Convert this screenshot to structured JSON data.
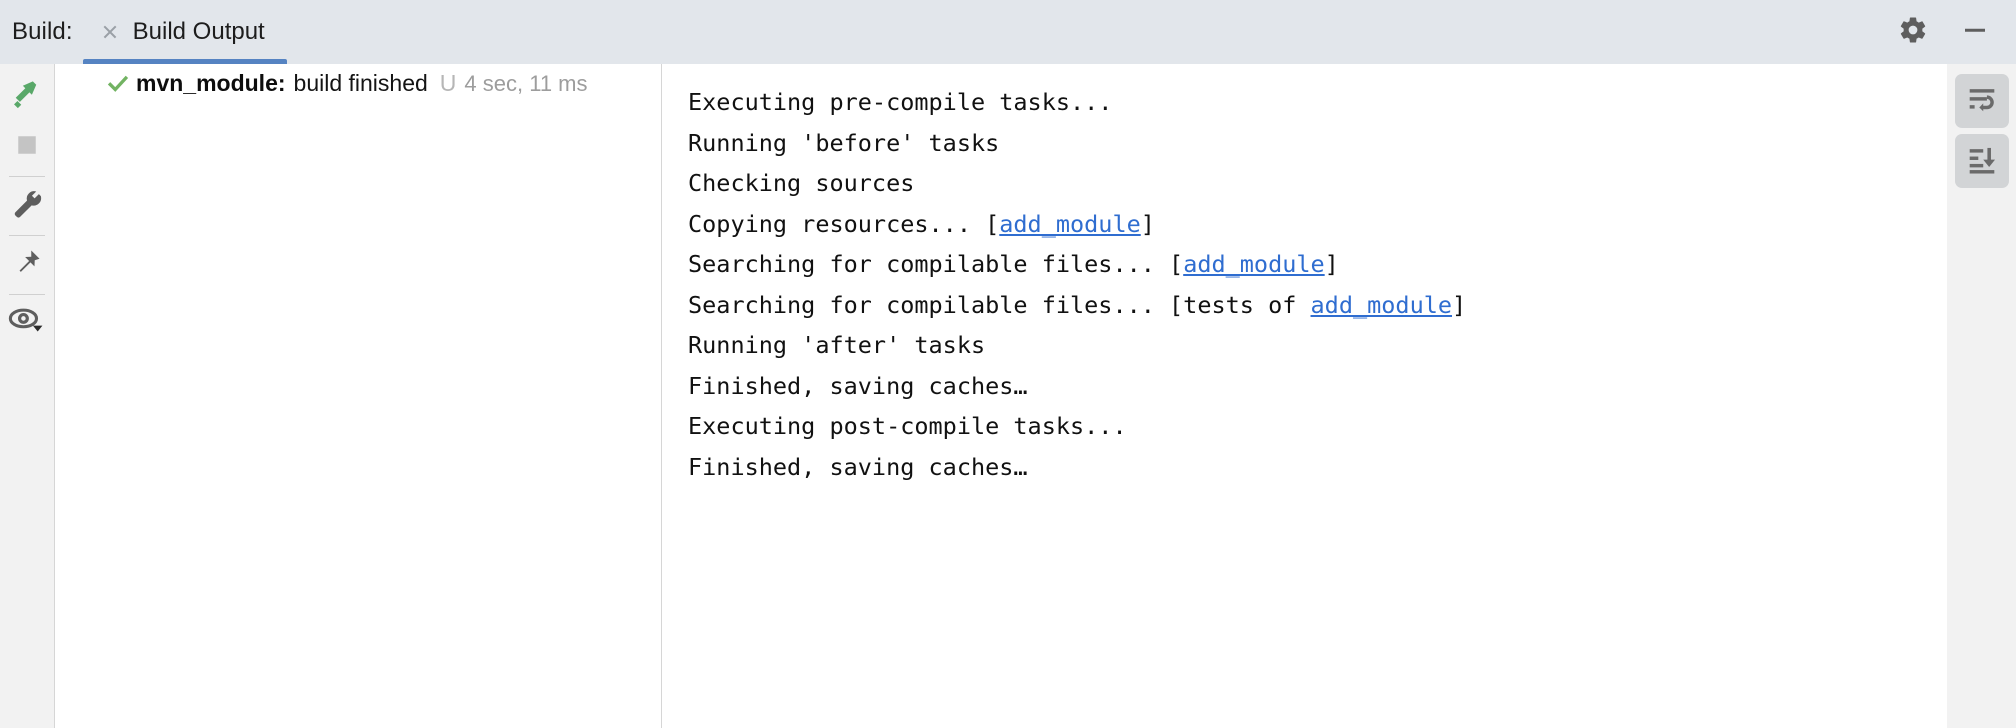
{
  "header": {
    "title": "Build:",
    "tab": {
      "label": "Build Output",
      "close_icon": "close-icon",
      "active": true
    },
    "actions": [
      {
        "name": "settings-button",
        "icon": "gear-icon",
        "label": ""
      },
      {
        "name": "minimize-button",
        "icon": "minimize-icon",
        "label": ""
      }
    ],
    "accent_color": "#5583c2",
    "background_color": "#e2e6eb"
  },
  "left_toolbar": {
    "items": [
      {
        "name": "rerun-build-button",
        "icon": "hammer-icon",
        "color": "#59a869"
      },
      {
        "name": "stop-build-button",
        "icon": "stop-square-icon",
        "color": "#c4c4c4"
      },
      {
        "name": "build-settings-button",
        "icon": "wrench-icon",
        "color": "#5e5e5e"
      },
      {
        "name": "pin-tab-button",
        "icon": "pin-icon",
        "color": "#5e5e5e"
      },
      {
        "name": "show-filters-button",
        "icon": "eye-icon",
        "color": "#5e5e5e"
      }
    ]
  },
  "right_toolbar": {
    "items": [
      {
        "name": "soft-wrap-button",
        "icon": "soft-wrap-icon"
      },
      {
        "name": "scroll-to-end-button",
        "icon": "scroll-to-end-icon"
      }
    ]
  },
  "tree": {
    "rows": [
      {
        "name": "build-result-row",
        "status_icon": "green-check-icon",
        "module": "mvn_module:",
        "status": "build finished",
        "separator": "U",
        "duration": "4 sec, 11 ms",
        "duration_color": "#9d9d9d"
      }
    ]
  },
  "console": {
    "lines": [
      {
        "segments": [
          {
            "t": "Executing pre-compile tasks...",
            "link": false
          }
        ]
      },
      {
        "segments": [
          {
            "t": "Running 'before' tasks",
            "link": false
          }
        ]
      },
      {
        "segments": [
          {
            "t": "Checking sources",
            "link": false
          }
        ]
      },
      {
        "segments": [
          {
            "t": "Copying resources... [",
            "link": false
          },
          {
            "t": "add_module",
            "link": true
          },
          {
            "t": "]",
            "link": false
          }
        ]
      },
      {
        "segments": [
          {
            "t": "Searching for compilable files... [",
            "link": false
          },
          {
            "t": "add_module",
            "link": true
          },
          {
            "t": "]",
            "link": false
          }
        ]
      },
      {
        "segments": [
          {
            "t": "Searching for compilable files... [tests of ",
            "link": false
          },
          {
            "t": "add_module",
            "link": true
          },
          {
            "t": "]",
            "link": false
          }
        ]
      },
      {
        "segments": [
          {
            "t": "Running 'after' tasks",
            "link": false
          }
        ]
      },
      {
        "segments": [
          {
            "t": "Finished, saving caches…",
            "link": false
          }
        ]
      },
      {
        "segments": [
          {
            "t": "Executing post-compile tasks...",
            "link": false
          }
        ]
      },
      {
        "segments": [
          {
            "t": "Finished, saving caches…",
            "link": false
          }
        ]
      }
    ],
    "link_color": "#2f6dd0",
    "text_color": "#111111"
  }
}
